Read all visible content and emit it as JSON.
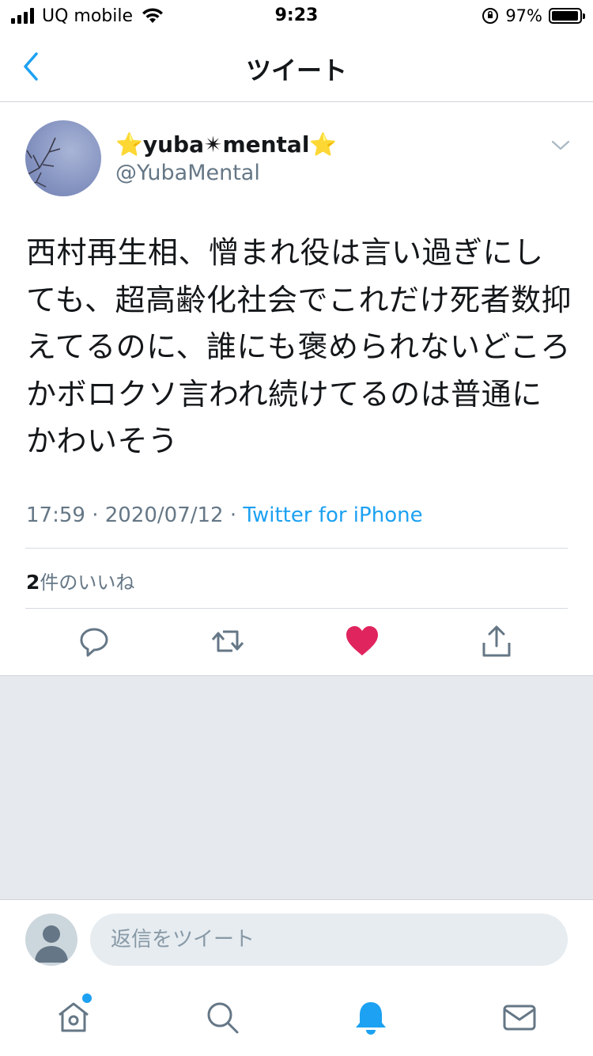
{
  "status_bar": {
    "carrier": "UQ mobile",
    "time": "9:23",
    "battery_percent_label": "97%",
    "battery_level": 0.97
  },
  "nav": {
    "title": "ツイート",
    "back_icon": "chevron-left-icon"
  },
  "tweet": {
    "display_name": "⭐yuba✴mental⭐",
    "handle": "@YubaMental",
    "text": "西村再生相、憎まれ役は言い過ぎにしても、超高齢化社会でこれだけ死者数抑えてるのに、誰にも褒められないどころかボロクソ言われ続けてるのは普通にかわいそう",
    "time": "17:59",
    "separator": "·",
    "date": "2020/07/12",
    "source": "Twitter for iPhone",
    "likes_count": "2",
    "likes_label": "件のいいね"
  },
  "actions": {
    "icons": [
      "reply-icon",
      "retweet-icon",
      "like-icon",
      "share-icon"
    ],
    "like_color": "#e0245e"
  },
  "reply": {
    "placeholder": "返信をツイート"
  },
  "tabbar": {
    "icons": [
      "home-icon",
      "search-icon",
      "notifications-icon",
      "messages-icon"
    ],
    "accent": "#1da1f2"
  }
}
